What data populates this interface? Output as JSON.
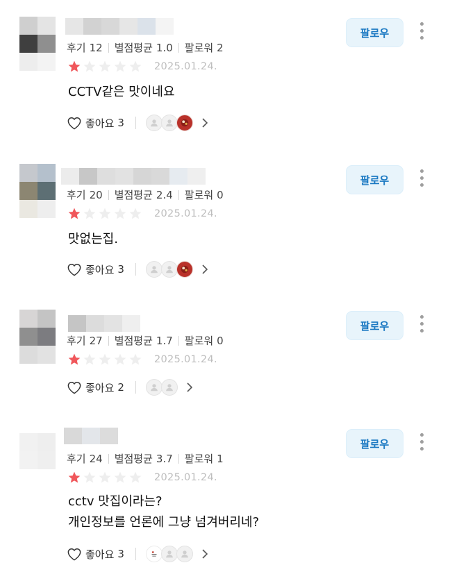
{
  "reviews": [
    {
      "stats": {
        "reviews_label": "후기",
        "reviews": "12",
        "avg_label": "별점평균",
        "avg": "1.0",
        "followers_label": "팔로워",
        "followers": "2"
      },
      "rating": 1,
      "date": "2025.01.24.",
      "text": [
        "CCTV같은 맛이네요"
      ],
      "likes": {
        "label": "좋아요",
        "count": "3"
      },
      "follow_label": "팔로우"
    },
    {
      "stats": {
        "reviews_label": "후기",
        "reviews": "20",
        "avg_label": "별점평균",
        "avg": "2.4",
        "followers_label": "팔로워",
        "followers": "0"
      },
      "rating": 1,
      "date": "2025.01.24.",
      "text": [
        "맛없는집."
      ],
      "likes": {
        "label": "좋아요",
        "count": "3"
      },
      "follow_label": "팔로우"
    },
    {
      "stats": {
        "reviews_label": "후기",
        "reviews": "27",
        "avg_label": "별점평균",
        "avg": "1.7",
        "followers_label": "팔로워",
        "followers": "0"
      },
      "rating": 1,
      "date": "2025.01.24.",
      "text": [],
      "likes": {
        "label": "좋아요",
        "count": "2"
      },
      "follow_label": "팔로우"
    },
    {
      "stats": {
        "reviews_label": "후기",
        "reviews": "24",
        "avg_label": "별점평균",
        "avg": "3.7",
        "followers_label": "팔로워",
        "followers": "1"
      },
      "rating": 1,
      "date": "2025.01.24.",
      "text": [
        "cctv 맛집이라는?",
        "개인정보를 언론에 그냥 넘겨버리네?"
      ],
      "likes": {
        "label": "좋아요",
        "count": "3"
      },
      "follow_label": "팔로우"
    }
  ],
  "colors": {
    "star_filled": "#f0575b",
    "star_empty": "#eeeeee",
    "follow_text": "#1a78c2",
    "follow_bg": "#e8f4fb"
  },
  "icons": {
    "star": "star-icon",
    "heart": "heart-outline-icon",
    "chevron": "chevron-right-icon",
    "more": "more-vertical-icon",
    "profile": "user-silhouette-icon"
  }
}
